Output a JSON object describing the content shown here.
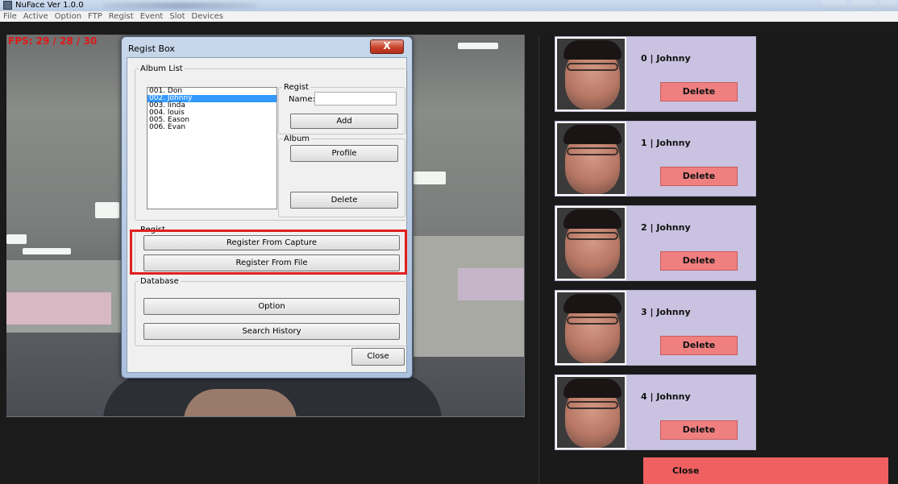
{
  "window": {
    "title": "NuFace Ver 1.0.0"
  },
  "menu": [
    "File",
    "Active",
    "Option",
    "FTP",
    "Regist",
    "Event",
    "Slot",
    "Devices"
  ],
  "camera": {
    "fps_text": "FPS: 29 / 28 / 30"
  },
  "dialog": {
    "title": "Regist Box",
    "close_glyph": "X",
    "album_list": {
      "legend": "Album List",
      "items": [
        "001. Don",
        "002. Johnny",
        "003. linda",
        "004. louis",
        "005. Eason",
        "006. Evan"
      ],
      "selected_index": 1
    },
    "regist": {
      "legend": "Regist",
      "name_label": "Name:",
      "name_value": "",
      "add_label": "Add"
    },
    "album": {
      "legend": "Album",
      "profile_label": "Profile",
      "delete_label": "Delete"
    },
    "regist2": {
      "legend": "Regist",
      "capture_label": "Register From Capture",
      "file_label": "Register From File"
    },
    "database": {
      "legend": "Database",
      "option_label": "Option",
      "history_label": "Search History"
    },
    "close_label": "Close"
  },
  "gallery": {
    "cards": [
      {
        "label": "0 | Johnny",
        "delete": "Delete"
      },
      {
        "label": "1 | Johnny",
        "delete": "Delete"
      },
      {
        "label": "2 | Johnny",
        "delete": "Delete"
      },
      {
        "label": "3 | Johnny",
        "delete": "Delete"
      },
      {
        "label": "4 | Johnny",
        "delete": "Delete"
      }
    ],
    "close_label": "Close"
  },
  "colors": {
    "fps": "#e01818",
    "card_bg": "#c9c2e0",
    "delete_btn": "#f08080",
    "close_btn": "#f06060",
    "highlight": "#e02020"
  }
}
